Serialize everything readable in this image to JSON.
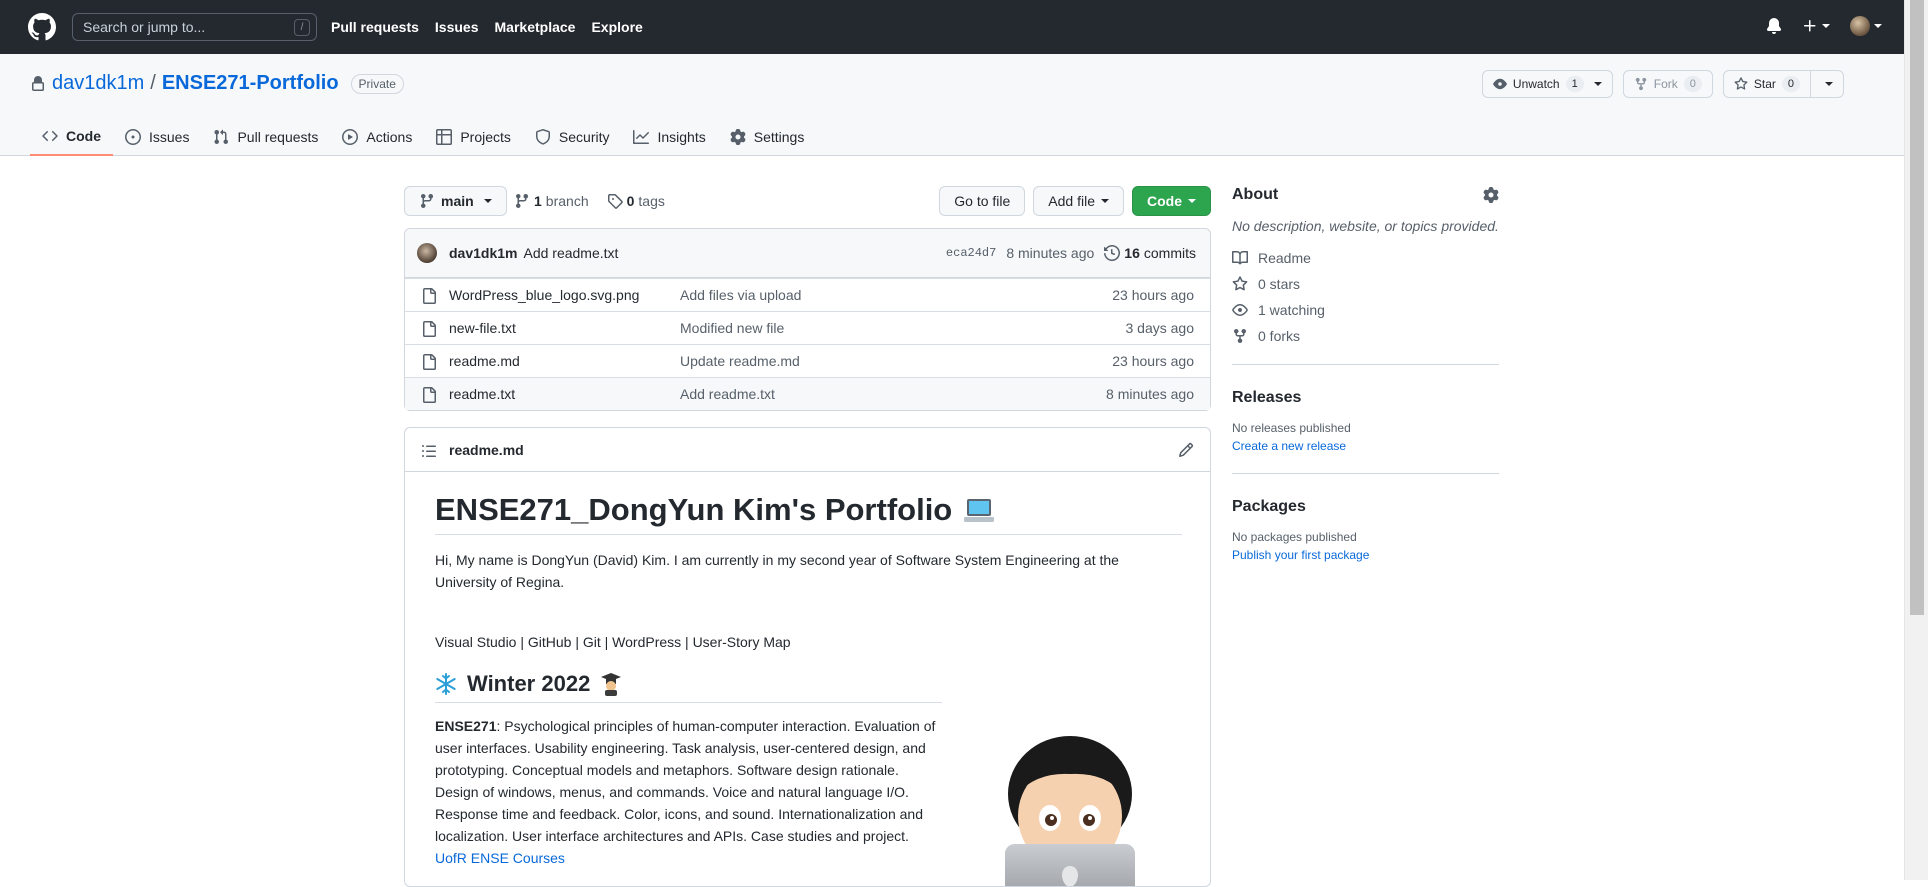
{
  "header": {
    "search_placeholder": "Search or jump to...",
    "search_shortcut": "/",
    "nav": [
      "Pull requests",
      "Issues",
      "Marketplace",
      "Explore"
    ]
  },
  "repo": {
    "owner": "dav1dk1m",
    "separator": "/",
    "name": "ENSE271-Portfolio",
    "visibility": "Private",
    "unwatch_label": "Unwatch",
    "watch_count": "1",
    "fork_label": "Fork",
    "fork_count": "0",
    "star_label": "Star",
    "star_count": "0"
  },
  "tabs": [
    "Code",
    "Issues",
    "Pull requests",
    "Actions",
    "Projects",
    "Security",
    "Insights",
    "Settings"
  ],
  "toolbar": {
    "branch": "main",
    "branch_count": "1",
    "branch_label": "branch",
    "tag_count": "0",
    "tag_label": "tags",
    "goto_file": "Go to file",
    "add_file": "Add file",
    "code": "Code"
  },
  "latest_commit": {
    "author": "dav1dk1m",
    "message": "Add readme.txt",
    "sha": "eca24d7",
    "time": "8 minutes ago",
    "commit_count": "16",
    "commit_label": "commits"
  },
  "files": [
    {
      "name": "WordPress_blue_logo.svg.png",
      "message": "Add files via upload",
      "age": "23 hours ago"
    },
    {
      "name": "new-file.txt",
      "message": "Modified new file",
      "age": "3 days ago"
    },
    {
      "name": "readme.md",
      "message": "Update readme.md",
      "age": "23 hours ago"
    },
    {
      "name": "readme.txt",
      "message": "Add readme.txt",
      "age": "8 minutes ago"
    }
  ],
  "readme": {
    "filename": "readme.md",
    "title": "ENSE271_DongYun Kim's Portfolio",
    "intro": "Hi, My name is DongYun (David) Kim. I am currently in my second year of Software System Engineering at the University of Regina.",
    "tools": "Visual Studio | GitHub | Git | WordPress | User-Story Map",
    "section_title": "Winter 2022",
    "course_code": "ENSE271",
    "course_text": ": Psychological principles of human-computer interaction. Evaluation of user interfaces. Usability engineering. Task analysis, user-centered design, and prototyping. Conceptual models and metaphors. Software design rationale. Design of windows, menus, and commands. Voice and natural language I/O. Response time and feedback. Color, icons, and sound. Internationalization and localization. User interface architectures and APIs. Case studies and project. ",
    "course_link": "UofR ENSE Courses"
  },
  "sidebar": {
    "about_title": "About",
    "about_desc": "No description, website, or topics provided.",
    "readme_label": "Readme",
    "stars": "0 stars",
    "watching": "1 watching",
    "forks": "0 forks",
    "releases_title": "Releases",
    "releases_none": "No releases published",
    "releases_link": "Create a new release",
    "packages_title": "Packages",
    "packages_none": "No packages published",
    "packages_link": "Publish your first package"
  },
  "colors": {
    "header_bg": "#24292f",
    "link": "#0969da",
    "green_button": "#2da44e",
    "active_tab_underline": "#fd8c73"
  }
}
